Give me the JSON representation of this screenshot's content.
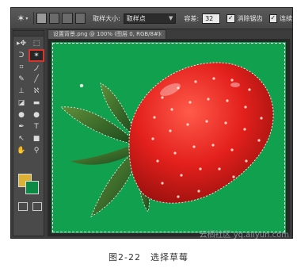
{
  "options_bar": {
    "sample_size_label": "取样大小:",
    "sample_size_value": "取样点",
    "tolerance_label": "容差:",
    "tolerance_value": "32",
    "antialias_label": "消除锯齿",
    "contiguous_label": "连续"
  },
  "document": {
    "tab_title": "设置背景.png @ 100% (图层 0, RGB/8#)",
    "close_glyph": "×"
  },
  "toolbox": {
    "active_tool": "magic-wand",
    "foreground_color": "#dbb034",
    "background_color": "#0b8a45"
  },
  "canvas": {
    "background_color": "#11a04e",
    "subject": "strawberry"
  },
  "caption": "图2-22　选择草莓",
  "watermark": "云栖社区 yq.aliyun.com"
}
